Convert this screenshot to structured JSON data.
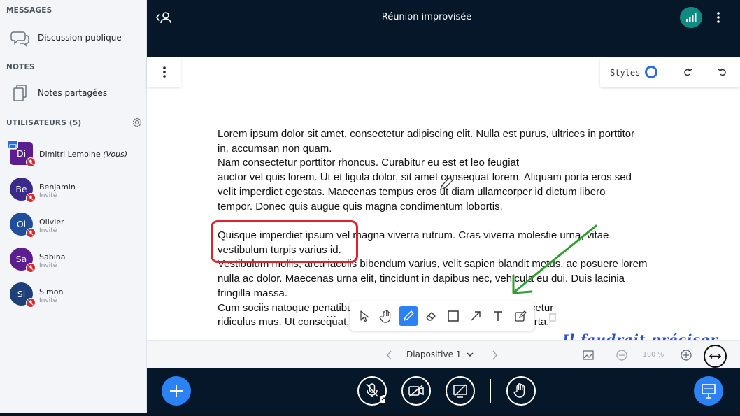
{
  "sidebar": {
    "messages_title": "MESSAGES",
    "public_chat": "Discussion publique",
    "notes_title": "NOTES",
    "shared_notes": "Notes partagées",
    "users_title": "UTILISATEURS (5)",
    "users": [
      {
        "initials": "Di",
        "name": "Dimitri Lemoine",
        "you": "(Vous)",
        "role": "",
        "color": "#5c1e8f",
        "presenter": true
      },
      {
        "initials": "Be",
        "name": "Benjamin",
        "you": "",
        "role": "Invité",
        "color": "#3b2a8a",
        "presenter": false
      },
      {
        "initials": "Ol",
        "name": "Olivier",
        "you": "",
        "role": "Invité",
        "color": "#1f4f9a",
        "presenter": false
      },
      {
        "initials": "Sa",
        "name": "Sabina",
        "you": "",
        "role": "Invité",
        "color": "#5c1e8f",
        "presenter": false
      },
      {
        "initials": "Si",
        "name": "Simon",
        "you": "",
        "role": "Invité",
        "color": "#1f3f7a",
        "presenter": false
      }
    ]
  },
  "header": {
    "title": "Réunion improvisée"
  },
  "whiteboard": {
    "styles_label": "Styles",
    "paragraph1": [
      "Lorem ipsum dolor sit amet, consectetur adipiscing elit. Nulla est purus, ultrices in porttitor",
      "in, accumsan non quam.",
      "Nam consectetur porttitor rhoncus. Curabitur eu est et leo feugiat",
      "auctor vel quis lorem. Ut et ligula dolor, sit amet consequat lorem. Aliquam porta eros sed",
      "velit imperdiet egestas. Maecenas tempus eros ut diam ullamcorper id dictum libero",
      "tempor. Donec quis augue quis magna condimentum lobortis."
    ],
    "paragraph2": [
      "Quisque imperdiet ipsum vel magna viverra rutrum. Cras viverra molestie urna, vitae",
      "vestibulum turpis varius id.",
      "Vestibulum mollis, arcu iaculis bibendum varius, velit sapien blandit metus, ac posuere lorem",
      "nulla ac dolor. Maecenas urna elit, tincidunt in dapibus nec, vehicula eu dui. Duis lacinia",
      "fringilla massa.",
      "Cum sociis natoque penatibus et magnis dis parturient montes, nascetur",
      "ridiculus mus. Ut consequat, lorem in ullamcorper congue, augue porta."
    ],
    "handwriting": "Il faudrait préciser",
    "toolbar_more": "...",
    "tools": [
      "select-tool",
      "hand-tool",
      "pencil-tool",
      "eraser-tool",
      "rectangle-tool",
      "arrow-tool",
      "text-tool",
      "note-tool"
    ],
    "active_tool": "pencil-tool"
  },
  "slidebar": {
    "slide_label": "Diapositive 1",
    "zoom": "100 %"
  },
  "colors": {
    "accent": "#2b82f4",
    "header_bg": "#06172a",
    "annotation_red": "#e0232a",
    "annotation_green": "#2ca02c",
    "handwriting_blue": "#2c4fd8"
  }
}
